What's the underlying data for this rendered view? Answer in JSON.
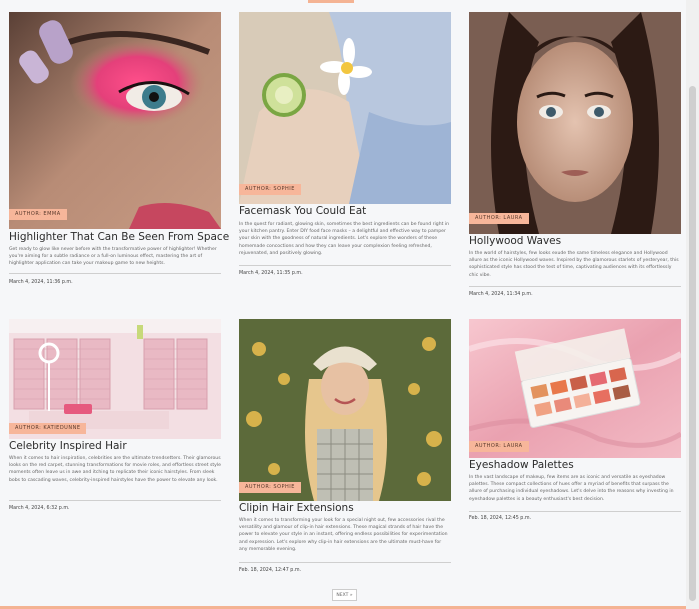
{
  "posts": [
    {
      "author": "AUTHOR: EMMA",
      "title": "Highlighter That Can Be Seen From Space",
      "excerpt": "Get ready to glow like never before with the transformative power of highlighter! Whether you're aiming for a subtle radiance or a full-on luminous effect, mastering the art of highlighter application can take your makeup game to new heights.",
      "date": "March 4, 2024, 11:36 p.m.",
      "image": "close-up eye with pink eyeshadow"
    },
    {
      "author": "AUTHOR: SOPHIE",
      "title": "Facemask You Could Eat",
      "excerpt": "In the quest for radiant, glowing skin, sometimes the best ingredients can be found right in your kitchen pantry. Enter DIY food face masks – a delightful and effective way to pamper your skin with the goodness of natural ingredients. Let's explore the wonders of these homemade concoctions and how they can leave your complexion feeling refreshed, rejuvenated, and positively glowing.",
      "date": "March 4, 2024, 11:35 p.m.",
      "image": "woman with cucumber slice facemask"
    },
    {
      "author": "AUTHOR: LAURA",
      "title": "Hollywood Waves",
      "excerpt": "In the world of hairstyles, few looks exude the same timeless elegance and Hollywood allure as the iconic Hollywood waves. Inspired by the glamorous starlets of yesteryear, this sophisticated style has stood the test of time, captivating audiences with its effortlessly chic vibe.",
      "date": "March 4, 2024, 11:34 p.m.",
      "image": "portrait with dark wavy hair"
    },
    {
      "author": "AUTHOR: KATIEDUNNE",
      "title": "Celebrity Inspired Hair",
      "excerpt": "When it comes to hair inspiration, celebrities are the ultimate trendsetters. Their glamorous looks on the red carpet, stunning transformations for movie roles, and effortless street style moments often leave us in awe and itching to replicate their iconic hairstyles. From sleek bobs to cascading waves, celebrity-inspired hairstyles have the power to elevate any look.",
      "date": "March 4, 2024, 6:32 p.m.",
      "image": "pink salon room with shutters"
    },
    {
      "author": "AUTHOR: SOPHIE",
      "title": "Clipin Hair Extensions",
      "excerpt": "When it comes to transforming your look for a special night out, few accessories rival the versatility and glamour of clip-in hair extensions. These magical strands of hair have the power to elevate your style in an instant, offering endless possibilities for experimentation and expression. Let's explore why clip-in hair extensions are the ultimate must-have for any memorable evening.",
      "date": "Feb. 18, 2024, 12:47 p.m.",
      "image": "blonde woman with bucket hat in field"
    },
    {
      "author": "AUTHOR: LAURA",
      "title": "Eyeshadow Palettes",
      "excerpt": "In the vast landscape of makeup, few items are as iconic and versatile as eyeshadow palettes. These compact collections of hues offer a myriad of benefits that surpass the allure of purchasing individual eyeshadows. Let's delve into the reasons why investing in eyeshadow palettes is a beauty enthusiast's best decision.",
      "date": "Feb. 18, 2024, 12:45 p.m.",
      "image": "eyeshadow palette on pink satin"
    }
  ],
  "pagination": {
    "next_label": "NEXT »"
  },
  "colors": {
    "accent": "#f7b69a",
    "background": "#f6f7f9"
  }
}
